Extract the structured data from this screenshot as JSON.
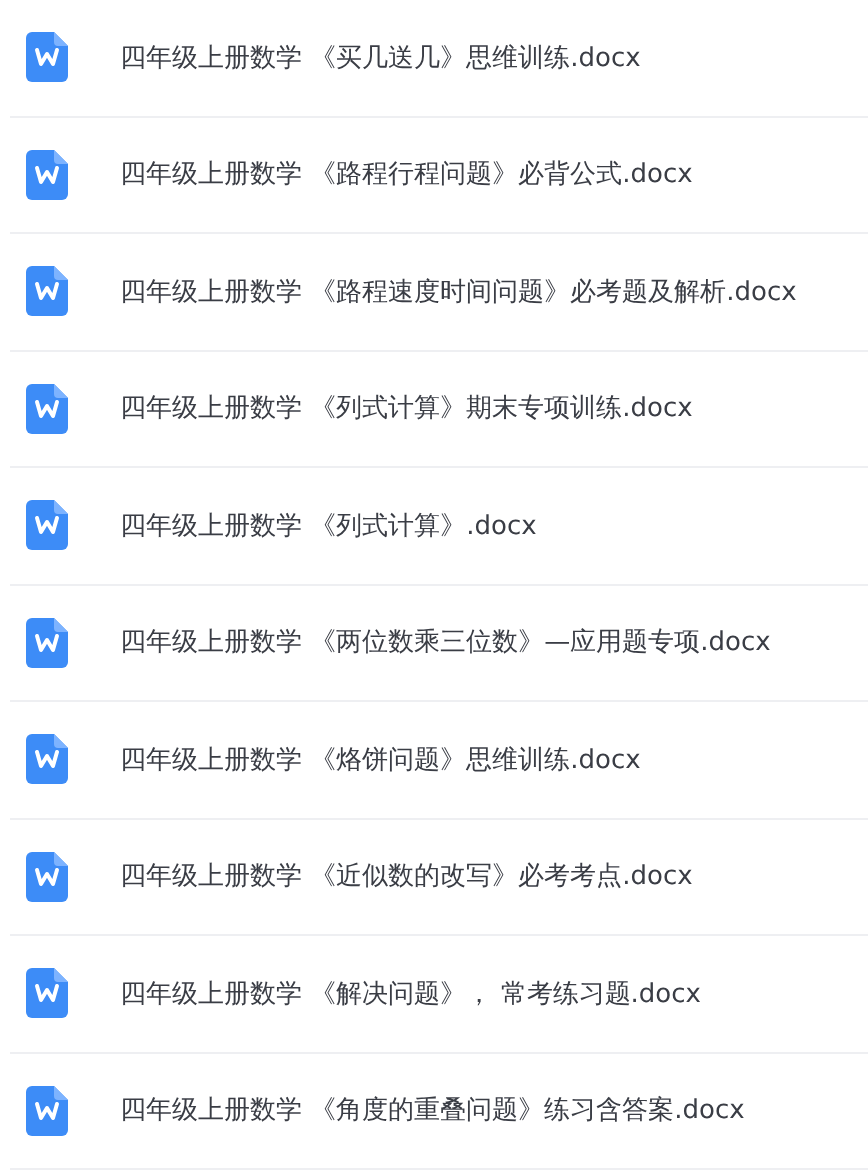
{
  "files": [
    {
      "name": "四年级上册数学 《买几送几》思维训练.docx"
    },
    {
      "name": "四年级上册数学 《路程行程问题》必背公式.docx"
    },
    {
      "name": "四年级上册数学 《路程速度时间问题》必考题及解析.docx"
    },
    {
      "name": "四年级上册数学 《列式计算》期末专项训练.docx"
    },
    {
      "name": "四年级上册数学 《列式计算》.docx"
    },
    {
      "name": "四年级上册数学 《两位数乘三位数》—应用题专项.docx"
    },
    {
      "name": "四年级上册数学 《烙饼问题》思维训练.docx"
    },
    {
      "name": "四年级上册数学 《近似数的改写》必考考点.docx"
    },
    {
      "name": "四年级上册数学 《解决问题》， 常考练习题.docx"
    },
    {
      "name": "四年级上册数学 《角度的重叠问题》练习含答案.docx"
    }
  ]
}
